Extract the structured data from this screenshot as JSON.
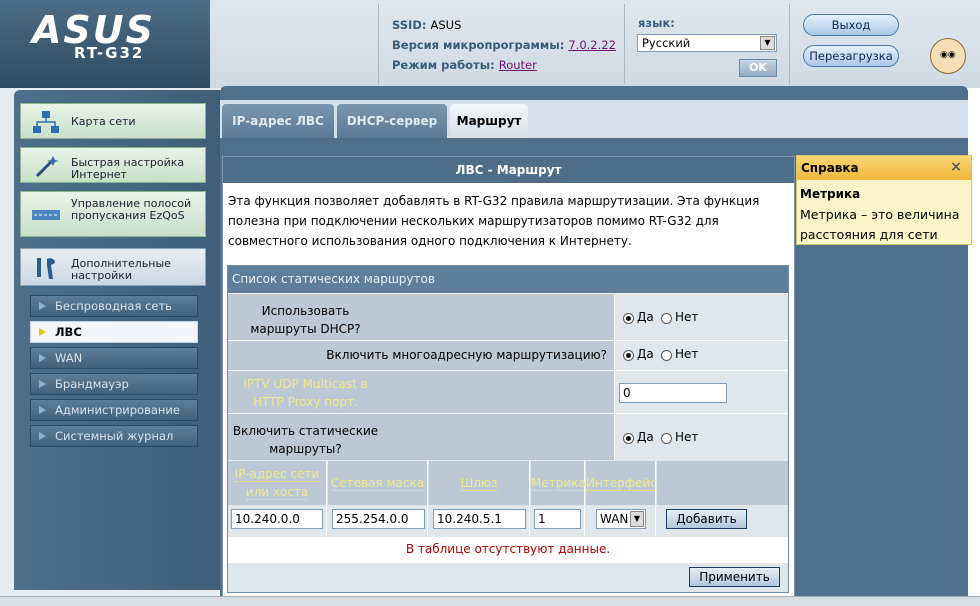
{
  "header": {
    "logo_text": "ASUS",
    "model": "RT-G32",
    "ssid_label": "SSID:",
    "ssid_value": "ASUS",
    "firmware_label": "Версия микропрограммы:",
    "firmware_value": "7.0.2.22",
    "mode_label": "Режим работы:",
    "mode_value": "Router",
    "language_label": "язык:",
    "language_value": "Русский",
    "ok_label": "OK",
    "logout_label": "Выход",
    "reboot_label": "Перезагрузка"
  },
  "sidebar": {
    "big_items": [
      {
        "label": "Карта сети"
      },
      {
        "label": "Быстрая настройка Интернет"
      },
      {
        "label": "Управление полосой пропускания EzQoS"
      },
      {
        "label": "Дополнительные настройки"
      }
    ],
    "sub_items": [
      {
        "label": "Беспроводная сеть"
      },
      {
        "label": "ЛВС"
      },
      {
        "label": "WAN"
      },
      {
        "label": "Брандмауэр"
      },
      {
        "label": "Администрирование"
      },
      {
        "label": "Системный журнал"
      }
    ]
  },
  "tabs": [
    {
      "label": "IP-адрес ЛВС"
    },
    {
      "label": "DHCP-сервер"
    },
    {
      "label": "Маршрут"
    }
  ],
  "content": {
    "title": "ЛВС - Маршрут",
    "description": "Эта функция позволяет добавлять в RT-G32 правила маршрутизации. Эта функция полезна при подключении нескольких маршрутизаторов помимо RT-G32 для совместного использования одного подключения к Интернету.",
    "table_title": "Список статических маршрутов",
    "rows": [
      {
        "label": "Использовать маршруты DHCP?",
        "yes": "Да",
        "no": "Нет"
      },
      {
        "label": "Включить многоадресную маршрутизацию?",
        "yes": "Да",
        "no": "Нет"
      },
      {
        "label": "IPTV UDP Multicast в HTTP Proxy порт.",
        "value": "0"
      },
      {
        "label": "Включить статические маршруты?",
        "yes": "Да",
        "no": "Нет"
      }
    ],
    "columns": [
      "IP-адрес сети или хоста",
      "Сетевая маска",
      "Шлюз",
      "Метрика",
      "Интерфейс"
    ],
    "inputs": {
      "ip": "10.240.0.0",
      "mask": "255.254.0.0",
      "gateway": "10.240.5.1",
      "metric": "1",
      "interface": "WAN"
    },
    "add_label": "Добавить",
    "empty_message": "В таблице отсутствуют данные.",
    "apply_label": "Применить"
  },
  "help": {
    "title": "Справка",
    "close": "×",
    "subtitle": "Метрика",
    "text": "Метрика – это величина расстояния для сети"
  }
}
